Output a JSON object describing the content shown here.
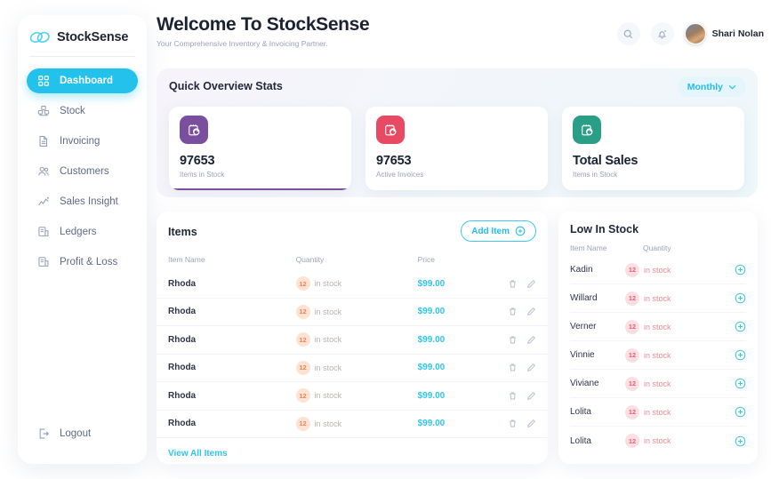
{
  "brand": {
    "name": "StockSense",
    "logo_icon": "infinity-loops-icon",
    "accent_color": "#22c2ec"
  },
  "sidebar": {
    "items": [
      {
        "label": "Dashboard",
        "icon": "dashboard-grid-icon",
        "active": true
      },
      {
        "label": "Stock",
        "icon": "boxes-stack-icon",
        "active": false
      },
      {
        "label": "Invoicing",
        "icon": "document-icon",
        "active": false
      },
      {
        "label": "Customers",
        "icon": "users-icon",
        "active": false
      },
      {
        "label": "Sales Insight",
        "icon": "line-chart-icon",
        "active": false
      },
      {
        "label": "Ledgers",
        "icon": "ledger-book-icon",
        "active": false
      },
      {
        "label": "Profit & Loss",
        "icon": "ledger-book-icon",
        "active": false
      }
    ],
    "logout": {
      "label": "Logout",
      "icon": "logout-arrow-icon"
    }
  },
  "header": {
    "title": "Welcome To StockSense",
    "subtitle": "Your Comprehensive Inventory & Invoicing Partner.",
    "search_icon": "search-icon",
    "notification_icon": "bell-icon",
    "user": {
      "name": "Shari Nolan",
      "avatar_icon": "avatar"
    }
  },
  "overview": {
    "title": "Quick Overview Stats",
    "period": {
      "label": "Monthly",
      "chevron_icon": "chevron-down-icon"
    },
    "cards": [
      {
        "value": "97653",
        "label": "Items in Stock",
        "icon": "calendar-refresh-icon",
        "color": "#7a4f9e",
        "active": true
      },
      {
        "value": "97653",
        "label": "Active Invoices",
        "icon": "calendar-refresh-icon",
        "color": "#e84a63",
        "active": false
      },
      {
        "value": "Total Sales",
        "label": "Items in Stock",
        "icon": "calendar-refresh-icon",
        "color": "#2a9e86",
        "active": false
      }
    ]
  },
  "items_panel": {
    "title": "Items",
    "add_button": {
      "label": "Add Item",
      "icon": "plus-circle-icon"
    },
    "columns": [
      "Item Name",
      "Quantity",
      "Price"
    ],
    "rows": [
      {
        "name": "Rhoda",
        "qty": "12",
        "qty_text": "in stock",
        "price": "$99.00"
      },
      {
        "name": "Rhoda",
        "qty": "12",
        "qty_text": "in stock",
        "price": "$99.00"
      },
      {
        "name": "Rhoda",
        "qty": "12",
        "qty_text": "in stock",
        "price": "$99.00"
      },
      {
        "name": "Rhoda",
        "qty": "12",
        "qty_text": "in stock",
        "price": "$99.00"
      },
      {
        "name": "Rhoda",
        "qty": "12",
        "qty_text": "in stock",
        "price": "$99.00"
      },
      {
        "name": "Rhoda",
        "qty": "12",
        "qty_text": "in stock",
        "price": "$99.00"
      }
    ],
    "row_actions": {
      "delete_icon": "trash-icon",
      "edit_icon": "pencil-icon"
    },
    "footer_link": "View All Items"
  },
  "low_stock_panel": {
    "title": "Low In Stock",
    "columns": [
      "Item Name",
      "Quantity"
    ],
    "rows": [
      {
        "name": "Kadin",
        "qty": "12",
        "qty_text": "in stock"
      },
      {
        "name": "Willard",
        "qty": "12",
        "qty_text": "in stock"
      },
      {
        "name": "Verner",
        "qty": "12",
        "qty_text": "in stock"
      },
      {
        "name": "Vinnie",
        "qty": "12",
        "qty_text": "in stock"
      },
      {
        "name": "Viviane",
        "qty": "12",
        "qty_text": "in stock"
      },
      {
        "name": "Lolita",
        "qty": "12",
        "qty_text": "in stock"
      },
      {
        "name": "Lolita",
        "qty": "12",
        "qty_text": "in stock"
      }
    ],
    "add_icon": "plus-circle-icon"
  }
}
